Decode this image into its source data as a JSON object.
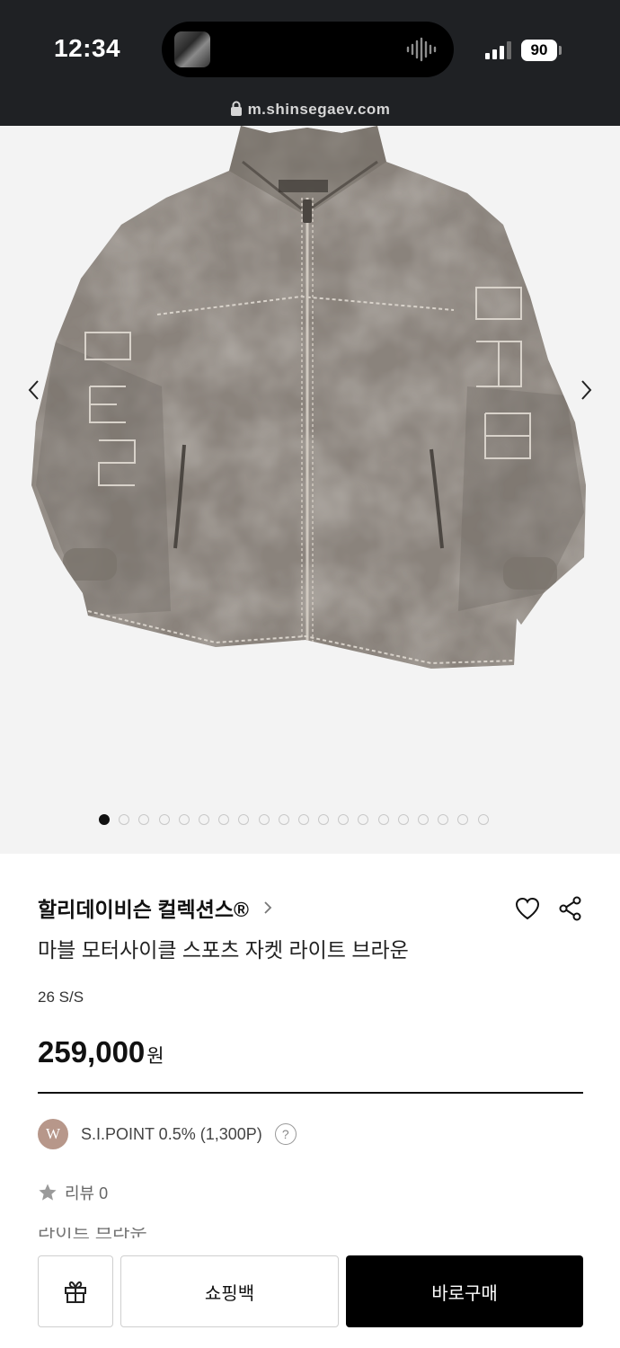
{
  "status_bar": {
    "time": "12:34",
    "battery": "90",
    "url": "m.shinsegaev.com"
  },
  "gallery": {
    "image": "tie-dye-zip-jacket-photo",
    "image_count": 20,
    "active_index": 0
  },
  "product": {
    "brand": "할리데이비슨 컬렉션스®",
    "name": "마블 모터사이클 스포츠 자켓 라이트 브라운",
    "season": "26 S/S",
    "price": "259,000",
    "currency": "원",
    "points": "S.I.POINT 0.5% (1,300P)",
    "points_badge": "W",
    "help": "?",
    "review": "리뷰 0",
    "partial_text": "라이트 브라운"
  },
  "actions": {
    "shopping_bag": "쇼핑백",
    "buy_now": "바로구매"
  },
  "colors": {
    "status_bar_bg": "#1f2124",
    "gallery_bg": "#f3f3f3",
    "badge_bg": "#b7978a",
    "buy_bg": "#000000"
  }
}
